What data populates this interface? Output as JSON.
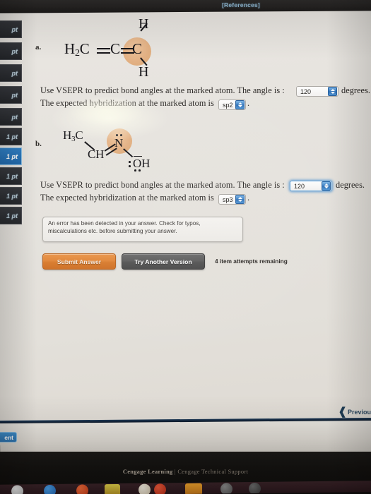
{
  "browser": {
    "references_label": "[References]"
  },
  "sidebar": {
    "items": [
      {
        "label": "pt",
        "active": false
      },
      {
        "label": "pt",
        "active": false
      },
      {
        "label": "pt",
        "active": false
      },
      {
        "label": "pt",
        "active": false
      },
      {
        "label": "pt",
        "active": false
      },
      {
        "label": "1 pt",
        "active": false
      },
      {
        "label": "1 pt",
        "active": true
      },
      {
        "label": "1 pt",
        "active": false
      },
      {
        "label": "1 pt",
        "active": false
      },
      {
        "label": "1 pt",
        "active": false
      }
    ],
    "assignment_chip_label": "ent"
  },
  "questions": [
    {
      "letter": "a.",
      "molecule": {
        "formula_text": "H2C=C=C",
        "atoms": [
          "H2C",
          "C",
          "C",
          "H",
          "H"
        ],
        "highlighted_atom": "C",
        "highlight_color": "#e3b184"
      },
      "prompt": "Use VSEPR to predict bond angles at the marked atom. The angle is :",
      "angle_value": "120",
      "angle_unit": "degrees.",
      "hybridization_prompt": "The expected hybridization at the marked atom is",
      "hybridization_value": "sp2",
      "hybridization_suffix": "."
    },
    {
      "letter": "b.",
      "molecule": {
        "formula_text": "H3C-CH=N-OH",
        "atoms": [
          "H3C",
          "CH",
          "N",
          "OH"
        ],
        "highlighted_atom": "N",
        "highlight_color": "#e3b184"
      },
      "prompt": "Use VSEPR to predict bond angles at the marked atom. The angle is :",
      "angle_value": "120",
      "angle_unit": "degrees.",
      "hybridization_prompt": "The expected hybridization at the marked atom is",
      "hybridization_value": "sp3",
      "hybridization_suffix": "."
    }
  ],
  "error_message": {
    "line1": "An error has been detected in your answer. Check for typos,",
    "line2": "miscalculations etc. before submitting your answer."
  },
  "actions": {
    "submit_label": "Submit Answer",
    "try_another_label": "Try Another Version",
    "attempts_label": "4 item attempts remaining",
    "submit_color": "#d87c2e",
    "try_another_color": "#545454"
  },
  "navigation": {
    "previous_label": "Previou"
  },
  "footer": {
    "brand": "Cengage Learning",
    "separator": "|",
    "support": "Cengage Technical Support"
  }
}
